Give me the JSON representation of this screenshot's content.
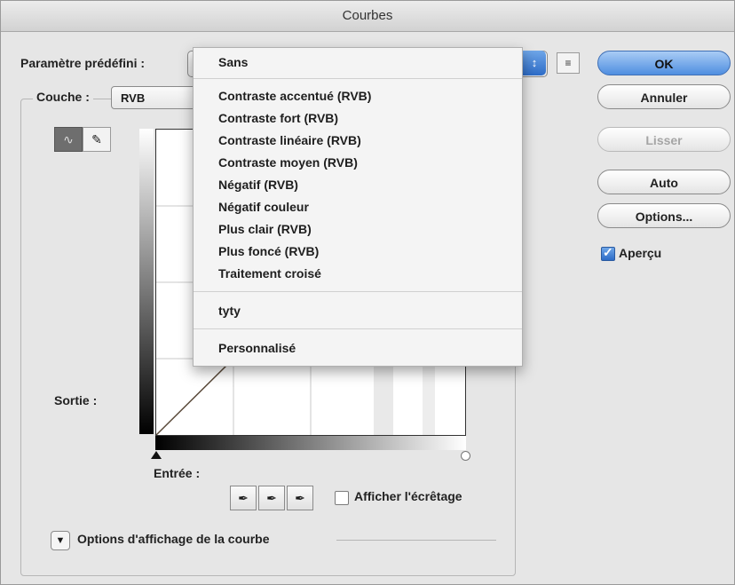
{
  "window": {
    "title": "Courbes"
  },
  "preset": {
    "label": "Paramètre prédéfini :"
  },
  "channel": {
    "label": "Couche :",
    "value": "RVB"
  },
  "labels": {
    "output": "Sortie :",
    "input": "Entrée :"
  },
  "checkboxes": {
    "show_clipping": {
      "label": "Afficher l'écrêtage",
      "checked": false
    },
    "preview": {
      "label": "Aperçu",
      "checked": true
    }
  },
  "curve_display_options": {
    "label": "Options d'affichage de la courbe"
  },
  "buttons": {
    "ok": "OK",
    "cancel": "Annuler",
    "smooth": "Lisser",
    "auto": "Auto",
    "options": "Options..."
  },
  "preset_menu": {
    "items": [
      "Sans",
      "Contraste accentué (RVB)",
      "Contraste fort (RVB)",
      "Contraste linéaire (RVB)",
      "Contraste moyen (RVB)",
      "Négatif (RVB)",
      "Négatif couleur",
      "Plus clair (RVB)",
      "Plus foncé (RVB)",
      "Traitement croisé",
      "tyty",
      "Personnalisé"
    ]
  },
  "icons": {
    "curve_tool": "curve-tool-icon",
    "pencil_tool": "pencil-icon",
    "black_eyedropper": "eyedropper-icon",
    "gray_eyedropper": "eyedropper-icon",
    "white_eyedropper": "eyedropper-icon",
    "preset_menu": "list-menu-icon",
    "disclosure": "disclosure-triangle-icon"
  },
  "colors": {
    "accent": "#4f8ee0"
  }
}
